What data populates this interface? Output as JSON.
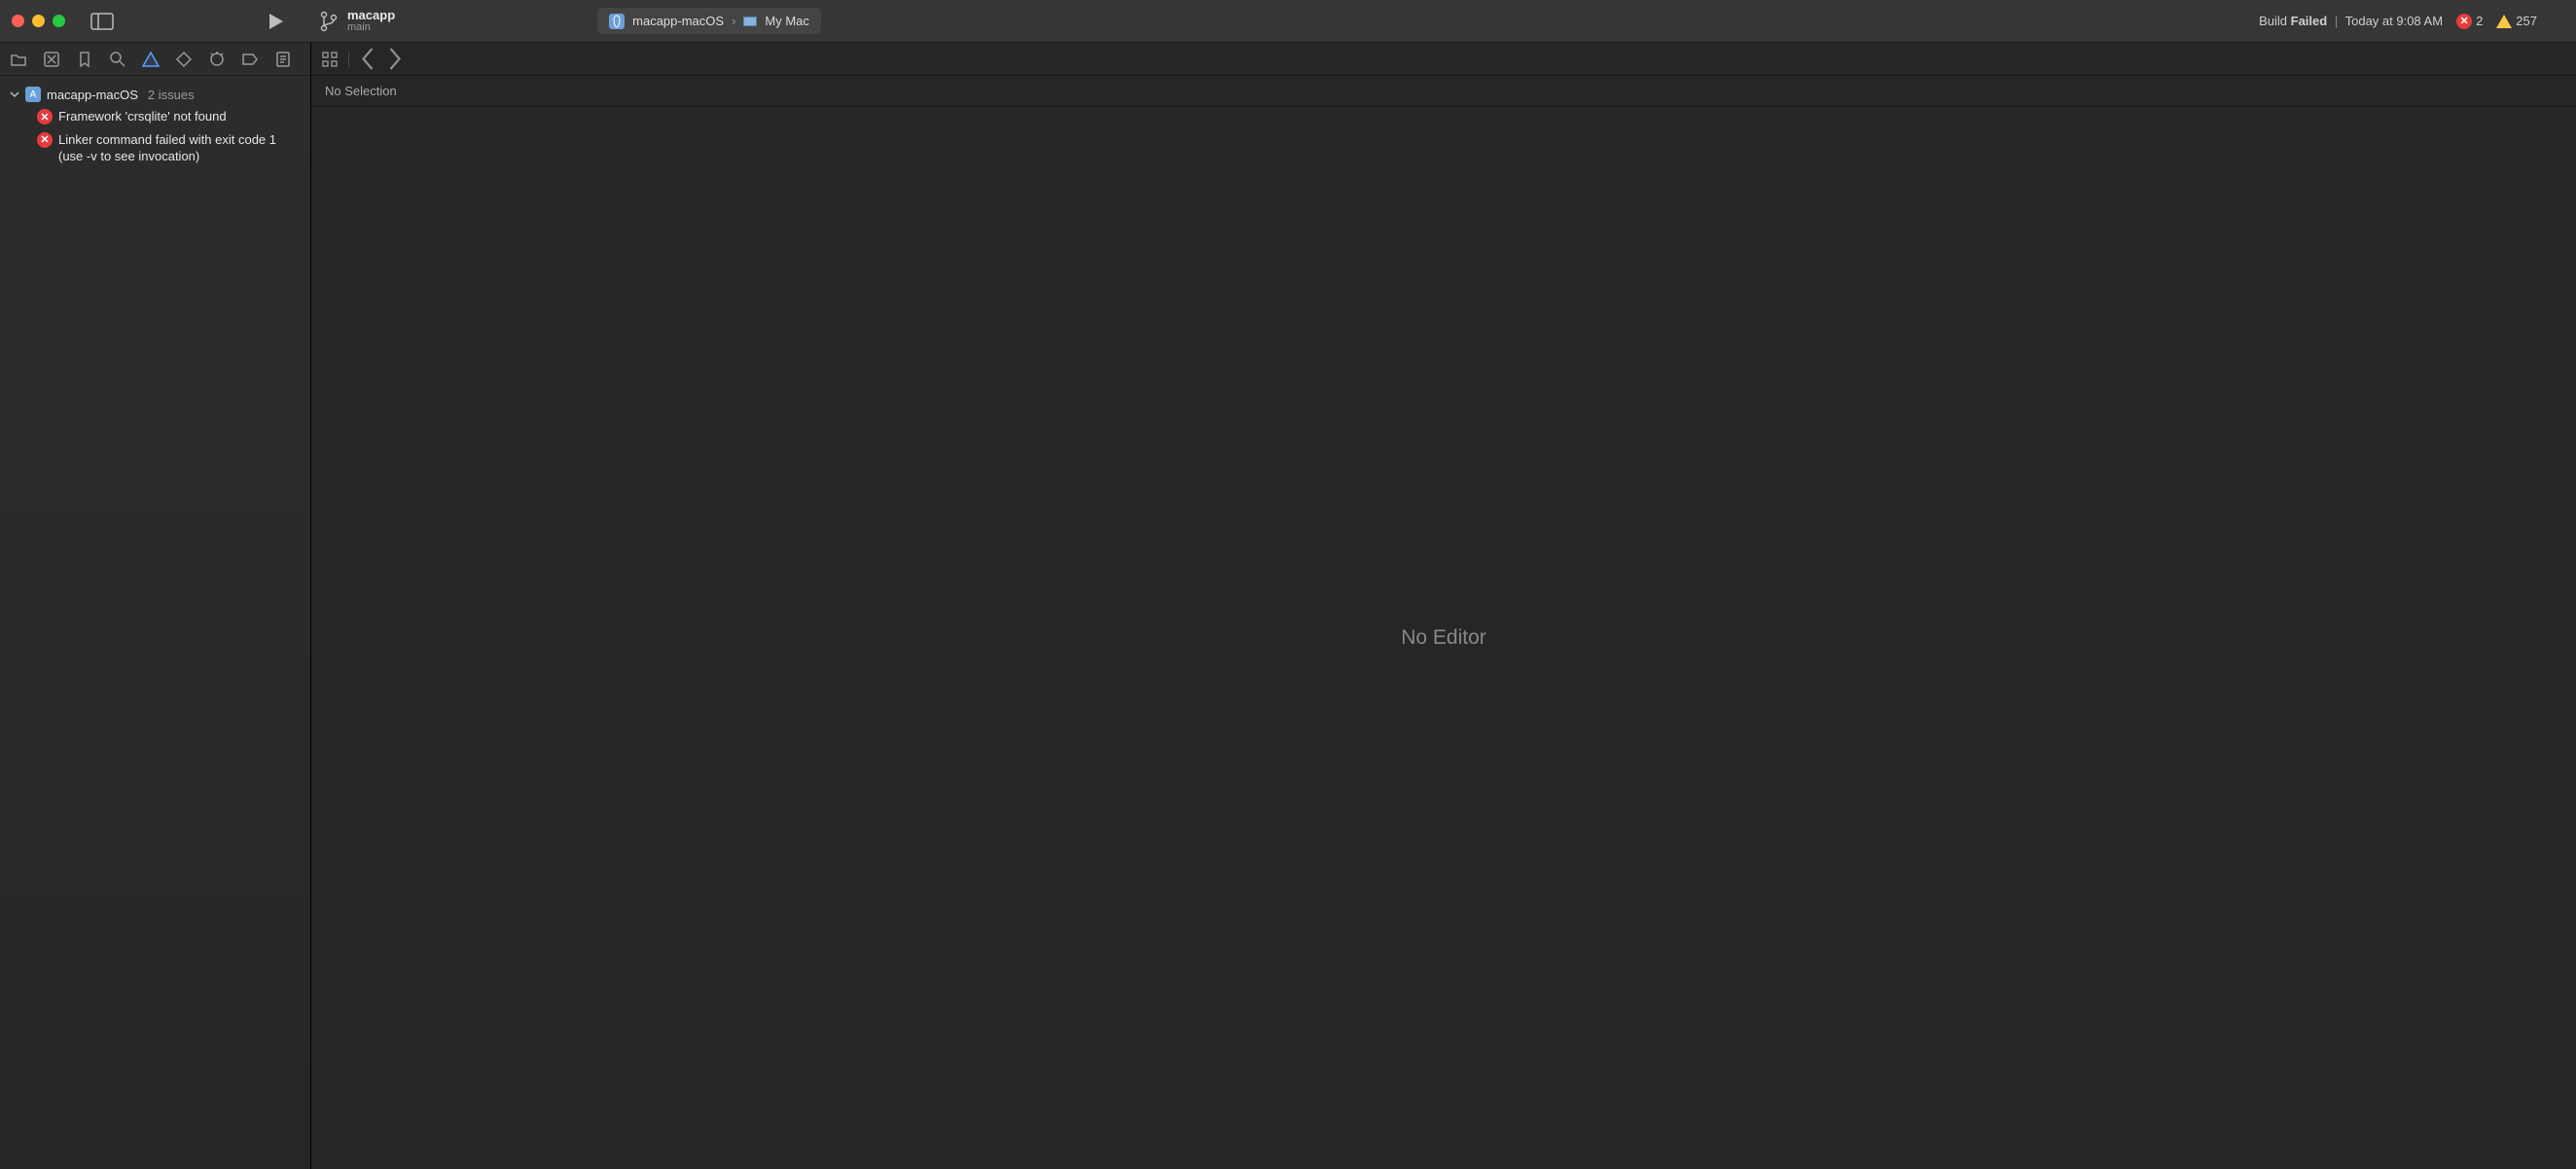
{
  "titlebar": {
    "project_name": "macapp",
    "branch": "main",
    "scheme": "macapp-macOS",
    "scheme_separator": "›",
    "destination": "My Mac",
    "status_prefix": "Build",
    "status_word": "Failed",
    "status_separator": "|",
    "status_time": "Today at 9:08 AM",
    "error_count": "2",
    "warning_count": "257"
  },
  "sidebar": {
    "project_label": "macapp-macOS",
    "issues_label": "2 issues",
    "issues": [
      {
        "text": "Framework 'crsqlite' not found"
      },
      {
        "text": "Linker command failed with exit code 1 (use -v to see invocation)"
      }
    ]
  },
  "jumpbar": {
    "text": "No Selection"
  },
  "editor": {
    "placeholder": "No Editor"
  }
}
